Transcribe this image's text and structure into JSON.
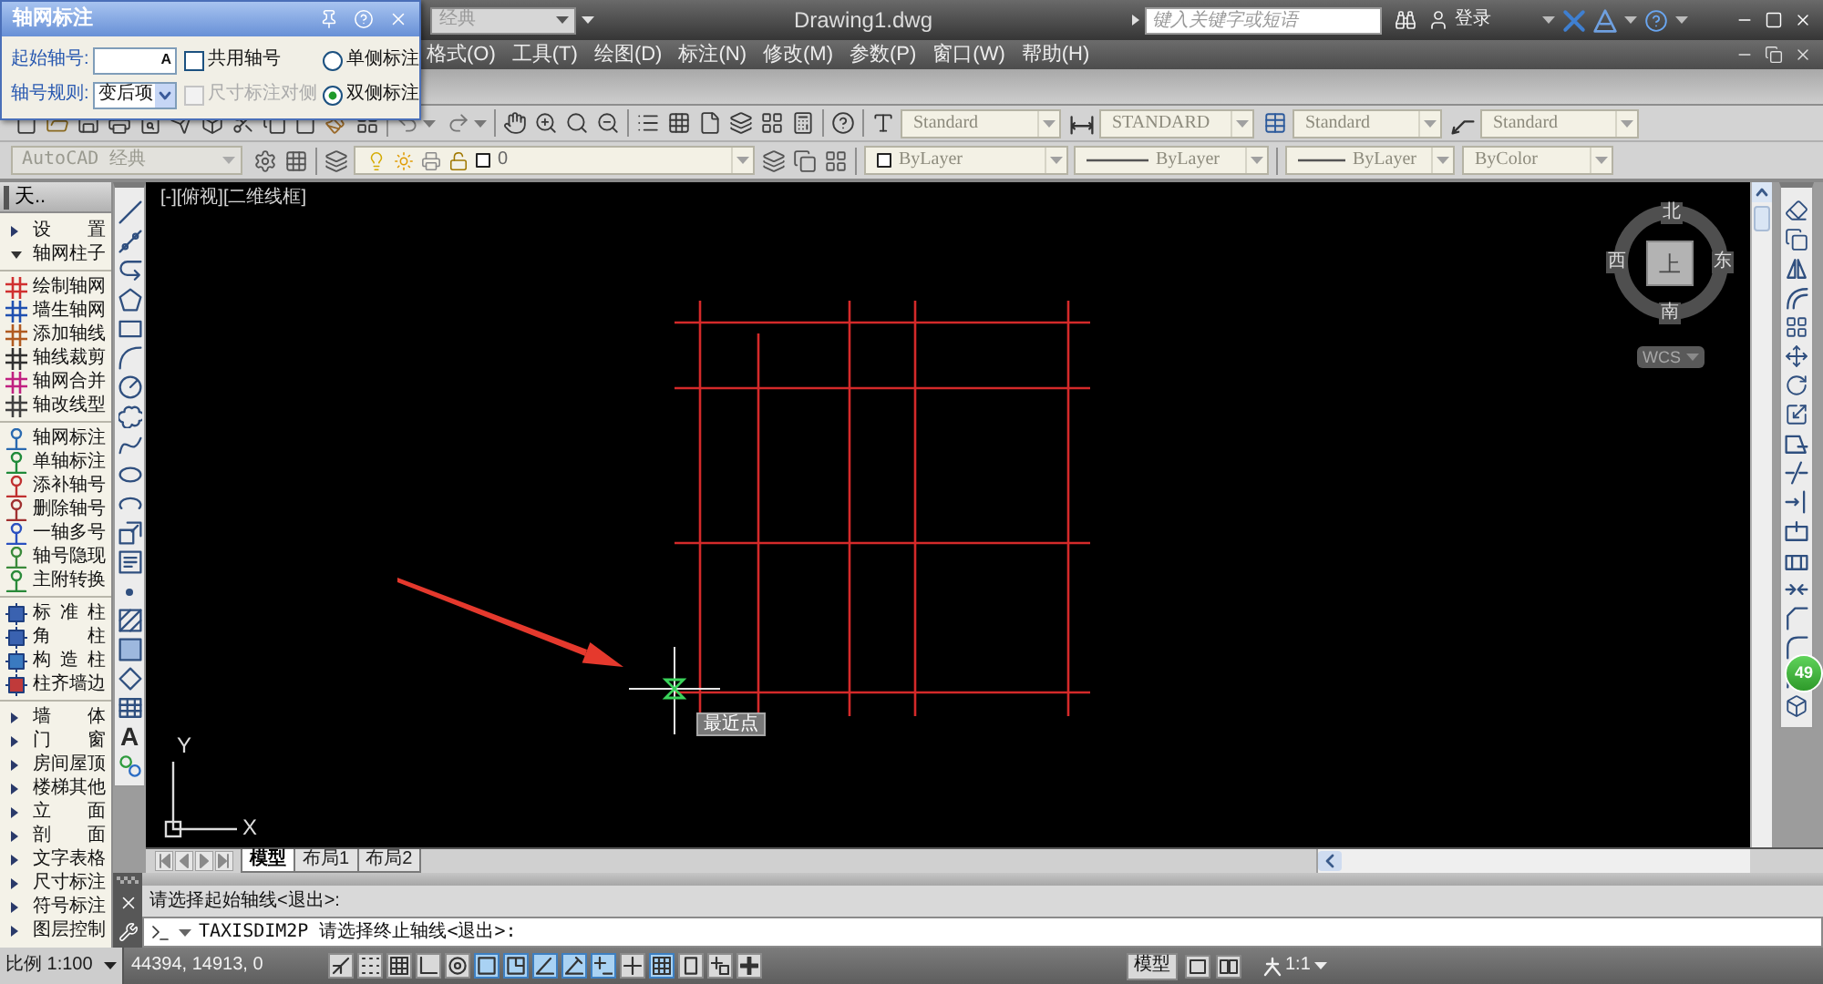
{
  "title_bar": {
    "workspace": "经典",
    "title": "Drawing1.dwg",
    "search": {
      "placeholder": "键入关键字或短语"
    },
    "sign_in": "登录"
  },
  "menu_bar": [
    "格式(O)",
    "工具(T)",
    "绘图(D)",
    "标注(N)",
    "修改(M)",
    "参数(P)",
    "窗口(W)",
    "帮助(H)"
  ],
  "dialog": {
    "title": "轴网标注",
    "start_number": {
      "label": "起始轴号:",
      "value": "A"
    },
    "shared_number": {
      "label": "共用轴号",
      "checked": false
    },
    "sides": [
      {
        "label": "单侧标注",
        "selected": false
      },
      {
        "label": "双侧标注",
        "selected": true
      }
    ],
    "rule": {
      "label": "轴号规则:",
      "value": "变后项"
    },
    "dim_opposite": {
      "label": "尺寸标注对侧",
      "checked": false,
      "disabled": true
    }
  },
  "styles_toolbar": [
    "Standard",
    "STANDARD",
    "Standard",
    "Standard"
  ],
  "layers_toolbar": {
    "workspace": "AutoCAD 经典",
    "layer": "0",
    "color_setting": "ByLayer",
    "linetype": "ByLayer",
    "lineweight": "ByLayer",
    "plot_style": "ByColor"
  },
  "sidebar": {
    "title": "天..",
    "groups": [
      {
        "label": "设 置",
        "expanded": false
      },
      {
        "label": "轴网柱子",
        "expanded": true,
        "sections": [
          {
            "children": [
              {
                "label": "绘制轴网"
              },
              {
                "label": "墙生轴网"
              },
              {
                "label": "添加轴线"
              },
              {
                "label": "轴线裁剪"
              },
              {
                "label": "轴网合并"
              },
              {
                "label": "轴改线型"
              }
            ]
          },
          {
            "children": [
              {
                "label": "轴网标注"
              },
              {
                "label": "单轴标注"
              },
              {
                "label": "添补轴号"
              },
              {
                "label": "删除轴号"
              },
              {
                "label": "一轴多号"
              },
              {
                "label": "轴号隐现"
              },
              {
                "label": "主附转换"
              }
            ]
          },
          {
            "children": [
              {
                "label": "标 准 柱"
              },
              {
                "label": "角 柱"
              },
              {
                "label": "构 造 柱"
              },
              {
                "label": "柱齐墙边"
              }
            ]
          }
        ]
      },
      {
        "label": "墙 体",
        "expanded": false
      },
      {
        "label": "门 窗",
        "expanded": false
      },
      {
        "label": "房间屋顶",
        "expanded": false
      },
      {
        "label": "楼梯其他",
        "expanded": false
      },
      {
        "label": "立 面",
        "expanded": false
      },
      {
        "label": "剖 面",
        "expanded": false
      },
      {
        "label": "文字表格",
        "expanded": false
      },
      {
        "label": "尺寸标注",
        "expanded": false
      },
      {
        "label": "符号标注",
        "expanded": false
      },
      {
        "label": "图层控制",
        "expanded": false
      }
    ]
  },
  "draw_toolbar": {
    "text_tool": "A"
  },
  "canvas": {
    "view_label": "[-][俯视][二维线框]",
    "snap_tooltip": "最近点",
    "ucs": {
      "y": "Y",
      "x": "X"
    },
    "view_cube": {
      "north": "北",
      "west": "西",
      "top": "上",
      "east": "东",
      "south": "南",
      "wcs": "WCS"
    }
  },
  "floating_badge": "49",
  "layout_tabs": [
    {
      "label": "模型",
      "selected": true
    },
    {
      "label": "布局1",
      "selected": false
    },
    {
      "label": "布局2",
      "selected": false
    }
  ],
  "command_line": {
    "history": [
      "请选择起始轴线<退出>:"
    ],
    "prompt": "TAXISDIM2P 请选择终止轴线<退出>:"
  },
  "status_bar": {
    "scale": "比例 1:100",
    "coordinates": "44394, 14913, 0",
    "toggles": [
      {
        "on": false
      },
      {
        "on": false
      },
      {
        "on": false
      },
      {
        "on": false
      },
      {
        "on": false
      },
      {
        "on": true
      },
      {
        "on": true
      },
      {
        "on": true
      },
      {
        "on": true
      },
      {
        "on": true
      },
      {
        "on": false
      },
      {
        "on": true
      },
      {
        "on": false
      },
      {
        "on": false
      },
      {
        "on": false
      }
    ],
    "space": "模型",
    "annotation_scale": "1:1"
  }
}
